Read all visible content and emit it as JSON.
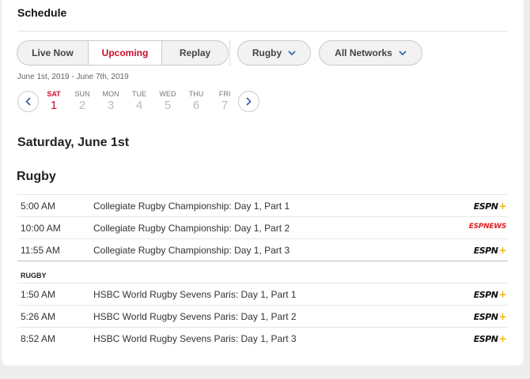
{
  "header": {
    "title": "Schedule"
  },
  "filters": {
    "tabs": [
      {
        "label": "Live Now",
        "active": false
      },
      {
        "label": "Upcoming",
        "active": true
      },
      {
        "label": "Replay",
        "active": false
      }
    ],
    "sport": "Rugby",
    "network": "All Networks"
  },
  "date_range": "June 1st, 2019 - June 7th, 2019",
  "days": [
    {
      "name": "SAT",
      "num": "1",
      "selected": true
    },
    {
      "name": "SUN",
      "num": "2",
      "selected": false
    },
    {
      "name": "MON",
      "num": "3",
      "selected": false
    },
    {
      "name": "TUE",
      "num": "4",
      "selected": false
    },
    {
      "name": "WED",
      "num": "5",
      "selected": false
    },
    {
      "name": "THU",
      "num": "6",
      "selected": false
    },
    {
      "name": "FRI",
      "num": "7",
      "selected": false
    }
  ],
  "selected_date_heading": "Saturday, June 1st",
  "sport_heading": "Rugby",
  "group1": [
    {
      "time": "5:00 AM",
      "event": "Collegiate Rugby Championship: Day 1, Part 1",
      "network": "ESPN+"
    },
    {
      "time": "10:00 AM",
      "event": "Collegiate Rugby Championship: Day 1, Part 2",
      "network": "ESPNEWS"
    },
    {
      "time": "11:55 AM",
      "event": "Collegiate Rugby Championship: Day 1, Part 3",
      "network": "ESPN+"
    }
  ],
  "subheading": "RUGBY",
  "group2": [
    {
      "time": "1:50 AM",
      "event": "HSBC World Rugby Sevens Paris: Day 1, Part 1",
      "network": "ESPN+"
    },
    {
      "time": "5:26 AM",
      "event": "HSBC World Rugby Sevens Paris: Day 1, Part 2",
      "network": "ESPN+"
    },
    {
      "time": "8:52 AM",
      "event": "HSBC World Rugby Sevens Paris: Day 1, Part 3",
      "network": "ESPN+"
    }
  ],
  "colors": {
    "accent": "#c8102e",
    "espn_plus": "#f2b705",
    "espnews": "#e01f26"
  }
}
